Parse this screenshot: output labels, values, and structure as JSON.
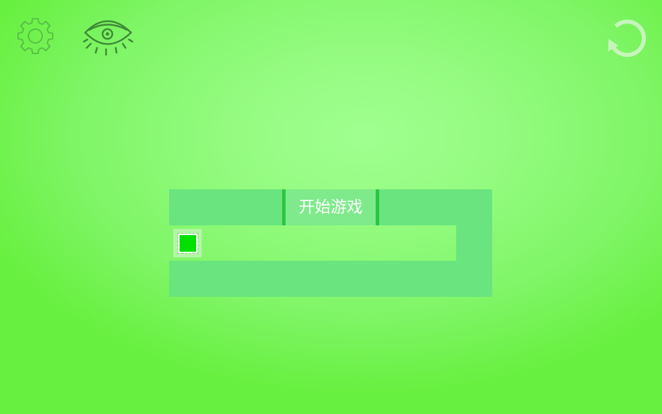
{
  "toolbar": {
    "settings_icon": "gear-icon",
    "view_icon": "eye-icon",
    "restart_icon": "restart-icon"
  },
  "menu": {
    "start_label": "开始游戏"
  },
  "colors": {
    "background": "#93fb7f",
    "maze_wall": "#6ae47e",
    "button_border": "#2bc640",
    "player": "#00e000"
  }
}
